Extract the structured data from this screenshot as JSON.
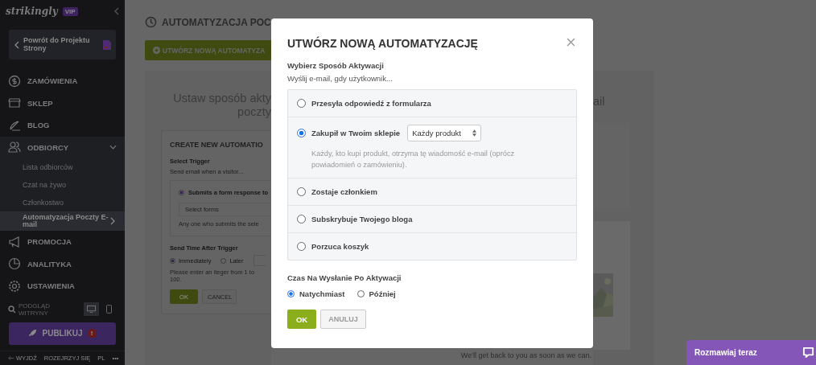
{
  "sidebar": {
    "logo": "strikingly",
    "badge": "VIP",
    "back_button": "Powrót do Projektu Strony",
    "nav": [
      {
        "label": "ZAMÓWIENIA"
      },
      {
        "label": "SKLEP"
      },
      {
        "label": "BLOG"
      },
      {
        "label": "ODBIORCY",
        "expanded": true,
        "children": [
          {
            "label": "Lista odbiorców",
            "selected": false
          },
          {
            "label": "Czat na żywo",
            "selected": false
          },
          {
            "label": "Członkostwo",
            "selected": false
          },
          {
            "label": "Automatyzacja Poczty E-mail",
            "selected": true
          }
        ]
      },
      {
        "label": "PROMOCJA"
      },
      {
        "label": "ANALITYKA"
      },
      {
        "label": "USTAWIENIA"
      }
    ],
    "preview": {
      "label": "PODGLĄD WITRYNY",
      "devices": [
        {
          "selected": true
        },
        {
          "selected": false
        }
      ]
    },
    "publish_button": "PUBLIKUJ",
    "publish_alert": "!",
    "footer": [
      "WYJDŹ",
      "ROZEJRZYJ SIĘ",
      "PL",
      "•••"
    ]
  },
  "page": {
    "title": "AUTOMATYZACJA POC",
    "create_button": "UTWÓRZ NOWĄ AUTOMATYZA",
    "intro": [
      "Ustaw sposób akty",
      "poczty"
    ],
    "intro_end": "ail",
    "form": {
      "title": "CREATE NEW AUTOMATIO",
      "trigger_label": "Select Trigger",
      "trigger_hint": "Send email when a visitor...",
      "option": {
        "label": "Submits a form response to",
        "selected": true
      },
      "select": "Select forms",
      "option_hint": "Any one who submits the sele",
      "time_label": "Send Time After Trigger",
      "time_options": [
        {
          "label": "Immediately",
          "selected": true
        },
        {
          "label": "Later",
          "selected": false
        }
      ],
      "time_hint": "Please enter an iteger  from 1 to 100.",
      "ok": "OK",
      "cancel": "CANCEL"
    },
    "footer_note": "We'll get back to you as soon as we can."
  },
  "dialog": {
    "title": "UTWÓRZ NOWĄ AUTOMATYZACJĘ",
    "trigger_label": "Wybierz Sposób Aktywacji",
    "trigger_hint": "Wyślij e-mail, gdy użytkownik...",
    "options": [
      {
        "label": "Przesyła odpowiedź z formularza",
        "selected": false
      },
      {
        "label": "Zakupił w Twoim sklepie",
        "selected": true,
        "select": "Każdy produkt",
        "description": "Każdy, kto kupi produkt, otrzyma tę wiadomość e-mail (oprócz powiadomień o zamówieniu)."
      },
      {
        "label": "Zostaje członkiem",
        "selected": false
      },
      {
        "label": "Subskrybuje Twojego bloga",
        "selected": false
      },
      {
        "label": "Porzuca koszyk",
        "selected": false
      }
    ],
    "time_label": "Czas Na Wysłanie Po Aktywacji",
    "time_options": [
      {
        "label": "Natychmiast",
        "selected": true
      },
      {
        "label": "Później",
        "selected": false
      }
    ],
    "ok": "OK",
    "cancel": "ANULUJ"
  },
  "chat_button": "Rozmawiaj teraz"
}
